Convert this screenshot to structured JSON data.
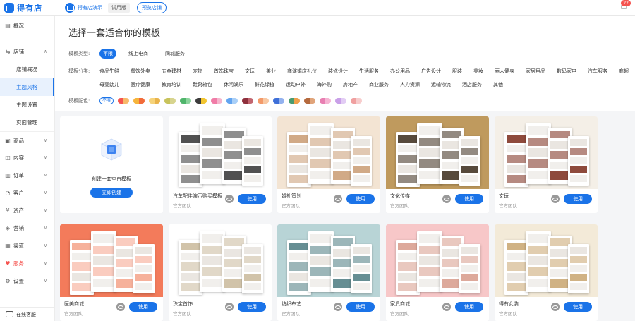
{
  "topbar": {
    "brand_name": "得有店",
    "shop_name": "得有店演示",
    "trial_label": "试用版",
    "preview_button": "预览店铺",
    "notification_count": "22"
  },
  "sidebar": {
    "items": [
      {
        "label": "概况",
        "icon": "home-icon"
      },
      {
        "label": "店铺",
        "icon": "store-icon",
        "expanded": true
      },
      {
        "label": "店铺概况",
        "sub": true
      },
      {
        "label": "主题风格",
        "sub": true,
        "active": true
      },
      {
        "label": "主题设置",
        "sub": true
      },
      {
        "label": "页面管理",
        "sub": true
      },
      {
        "label": "商品",
        "icon": "goods-icon"
      },
      {
        "label": "内容",
        "icon": "content-icon"
      },
      {
        "label": "订单",
        "icon": "order-icon"
      },
      {
        "label": "客户",
        "icon": "customer-icon"
      },
      {
        "label": "资产",
        "icon": "asset-icon"
      },
      {
        "label": "营销",
        "icon": "marketing-icon"
      },
      {
        "label": "渠道",
        "icon": "channel-icon"
      },
      {
        "label": "服务",
        "icon": "service-icon",
        "highlight": true
      },
      {
        "label": "设置",
        "icon": "settings-icon"
      }
    ],
    "online_service": "在线客服"
  },
  "main": {
    "title": "选择一套适合你的模板",
    "type_filter": {
      "label": "模板类型:",
      "options": [
        "不限",
        "线上电商",
        "同城服务"
      ],
      "selected": "不限"
    },
    "category_filter": {
      "label": "模板分类:",
      "row1": [
        "食品生鲜",
        "餐饮外卖",
        "五金建材",
        "宠物",
        "首饰珠宝",
        "文玩",
        "美业",
        "商演婚庆礼仪",
        "装修设计",
        "生活服务",
        "办公用品",
        "广告设计",
        "服装",
        "美妆",
        "丽人健身",
        "家居用品",
        "数码家电",
        "汽车服务",
        "商超"
      ],
      "row2": [
        "母婴幼儿",
        "医疗健康",
        "教育培训",
        "鞋靴箱包",
        "休闲娱乐",
        "鲜花绿植",
        "运动户外",
        "海外购",
        "房地产",
        "商业服务",
        "人力资源",
        "运输物流",
        "酒店服务",
        "其他"
      ]
    },
    "color_filter": {
      "label": "模板配色:",
      "none_label": "不限",
      "swatches": [
        [
          "#f5534f",
          "#f7b96a"
        ],
        [
          "#f6b43c",
          "#f26b3a"
        ],
        [
          "#f6d37a",
          "#e9b34a"
        ],
        [
          "#c8c35c",
          "#d7d48e"
        ],
        [
          "#4fb56b",
          "#8bd49c"
        ],
        [
          "#3d3d3d",
          "#f2c530"
        ],
        [
          "#f07ca7",
          "#f5b5cd"
        ],
        [
          "#62a4f0",
          "#a9cff7"
        ],
        [
          "#8e2f3c",
          "#c2656f"
        ],
        [
          "#f39a6a",
          "#f8c8a3"
        ],
        [
          "#3e6fd8",
          "#93b2ef"
        ],
        [
          "#4a9b6f",
          "#f0a04b"
        ],
        [
          "#b56a3e",
          "#e0a47a"
        ],
        [
          "#e87fb2",
          "#f6b4d3"
        ],
        [
          "#c9a0e8",
          "#e2ccf4"
        ],
        [
          "#f0a0a0",
          "#f7cccc"
        ]
      ]
    },
    "blank_card": {
      "text": "创建一套空白模板",
      "button": "立即创建"
    },
    "cards": [
      {
        "title": "汽车配件演示购买模板",
        "author": "官方团队",
        "bg": "#ffffff",
        "theme": "#333333"
      },
      {
        "title": "婚礼策划",
        "author": "官方团队",
        "bg": "#f3e4d3",
        "theme": "#c99b72"
      },
      {
        "title": "文化传媒",
        "author": "官方团队",
        "bg": "#bf9a5e",
        "theme": "#3a2a1a"
      },
      {
        "title": "文玩",
        "author": "官方团队",
        "bg": "#f4efe7",
        "theme": "#7a2a1a"
      },
      {
        "title": "医美商城",
        "author": "官方团队",
        "bg": "#f37b5b",
        "theme": "#f5a38a"
      },
      {
        "title": "珠宝首饰",
        "author": "官方团队",
        "bg": "#ffffff",
        "theme": "#c9b89a"
      },
      {
        "title": "纺织布艺",
        "author": "官方团队",
        "bg": "#b8d4d6",
        "theme": "#4b7a80"
      },
      {
        "title": "家具商城",
        "author": "官方团队",
        "bg": "#f7c7c8",
        "theme": "#d79a8a"
      },
      {
        "title": "得有女装",
        "author": "官方团队",
        "bg": "#f3ead8",
        "theme": "#c8a46e"
      }
    ],
    "use_label": "使用"
  }
}
